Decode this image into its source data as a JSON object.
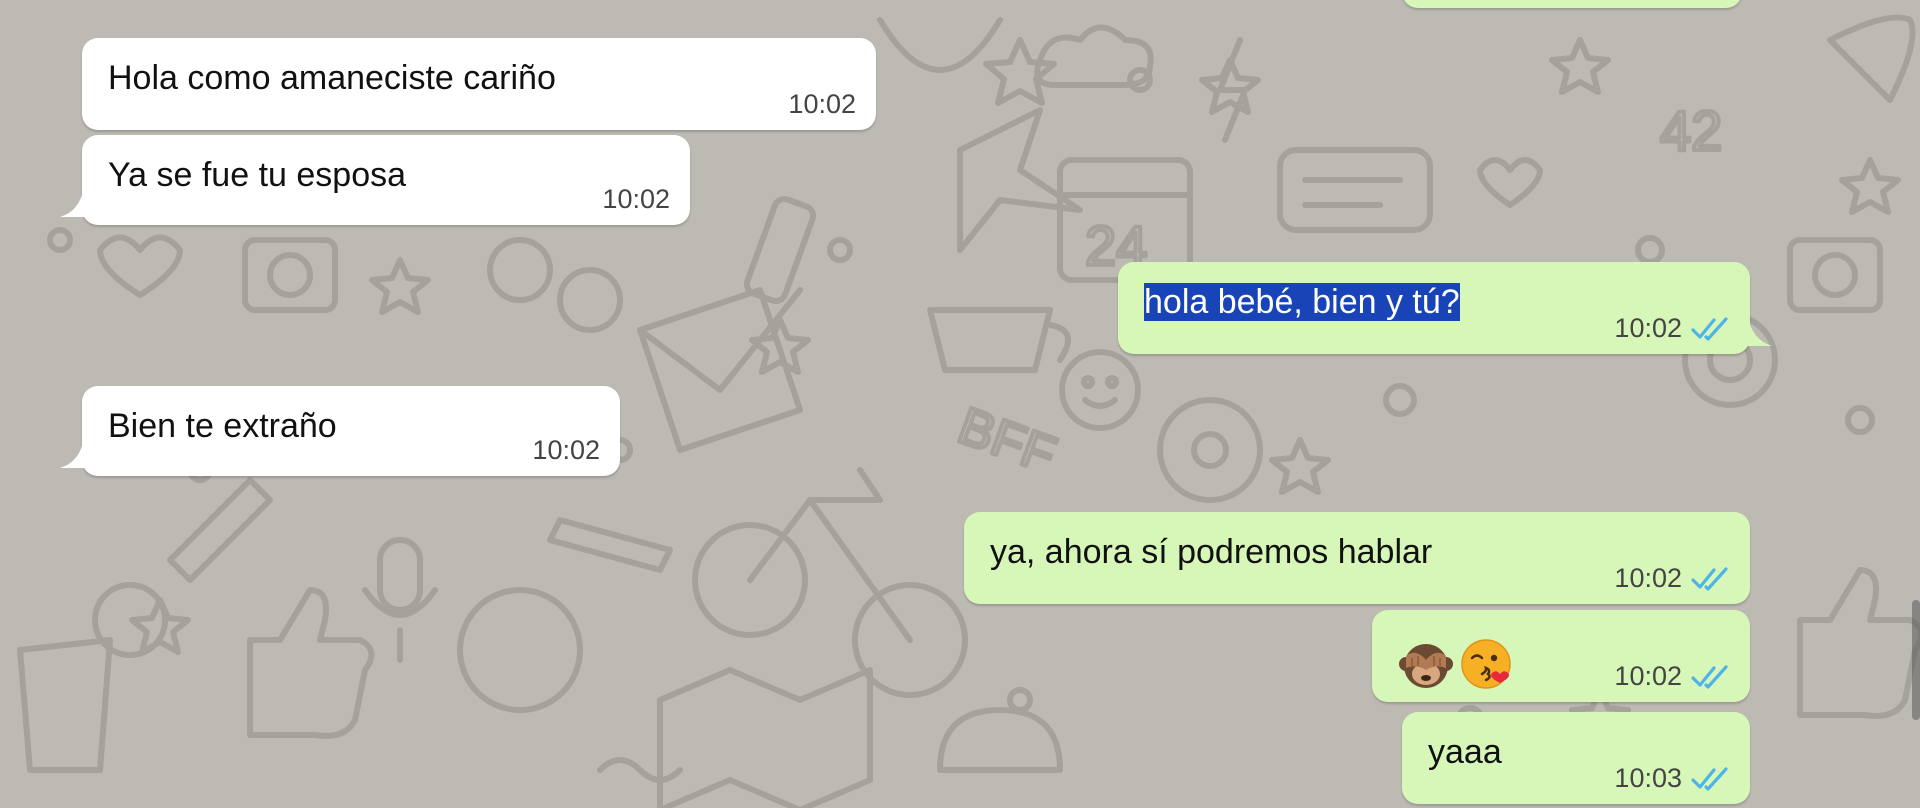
{
  "chat": {
    "messages": [
      {
        "direction": "incoming",
        "text": "Hola como amaneciste cariño",
        "time": "10:02"
      },
      {
        "direction": "incoming",
        "text": "Ya se fue tu esposa",
        "time": "10:02"
      },
      {
        "direction": "outgoing",
        "text": "hola bebé, bien y tú?",
        "time": "10:02",
        "status": "read",
        "selected": true
      },
      {
        "direction": "incoming",
        "text": "Bien te extraño",
        "time": "10:02"
      },
      {
        "direction": "outgoing",
        "text": "ya, ahora sí podremos hablar",
        "time": "10:02",
        "status": "read"
      },
      {
        "direction": "outgoing",
        "emojis": [
          "see-no-evil-monkey",
          "face-blowing-a-kiss"
        ],
        "time": "10:02",
        "status": "read"
      },
      {
        "direction": "outgoing",
        "text": "yaaa",
        "time": "10:03",
        "status": "read"
      }
    ]
  },
  "theme": {
    "wallpaper": "#bdbab4",
    "wallpaper_doodle": "#a5a29c",
    "incoming_bubble": "#ffffff",
    "outgoing_bubble": "#d7f7b8",
    "read_ticks": "#4fb3e8",
    "selection": "#1844b8"
  }
}
